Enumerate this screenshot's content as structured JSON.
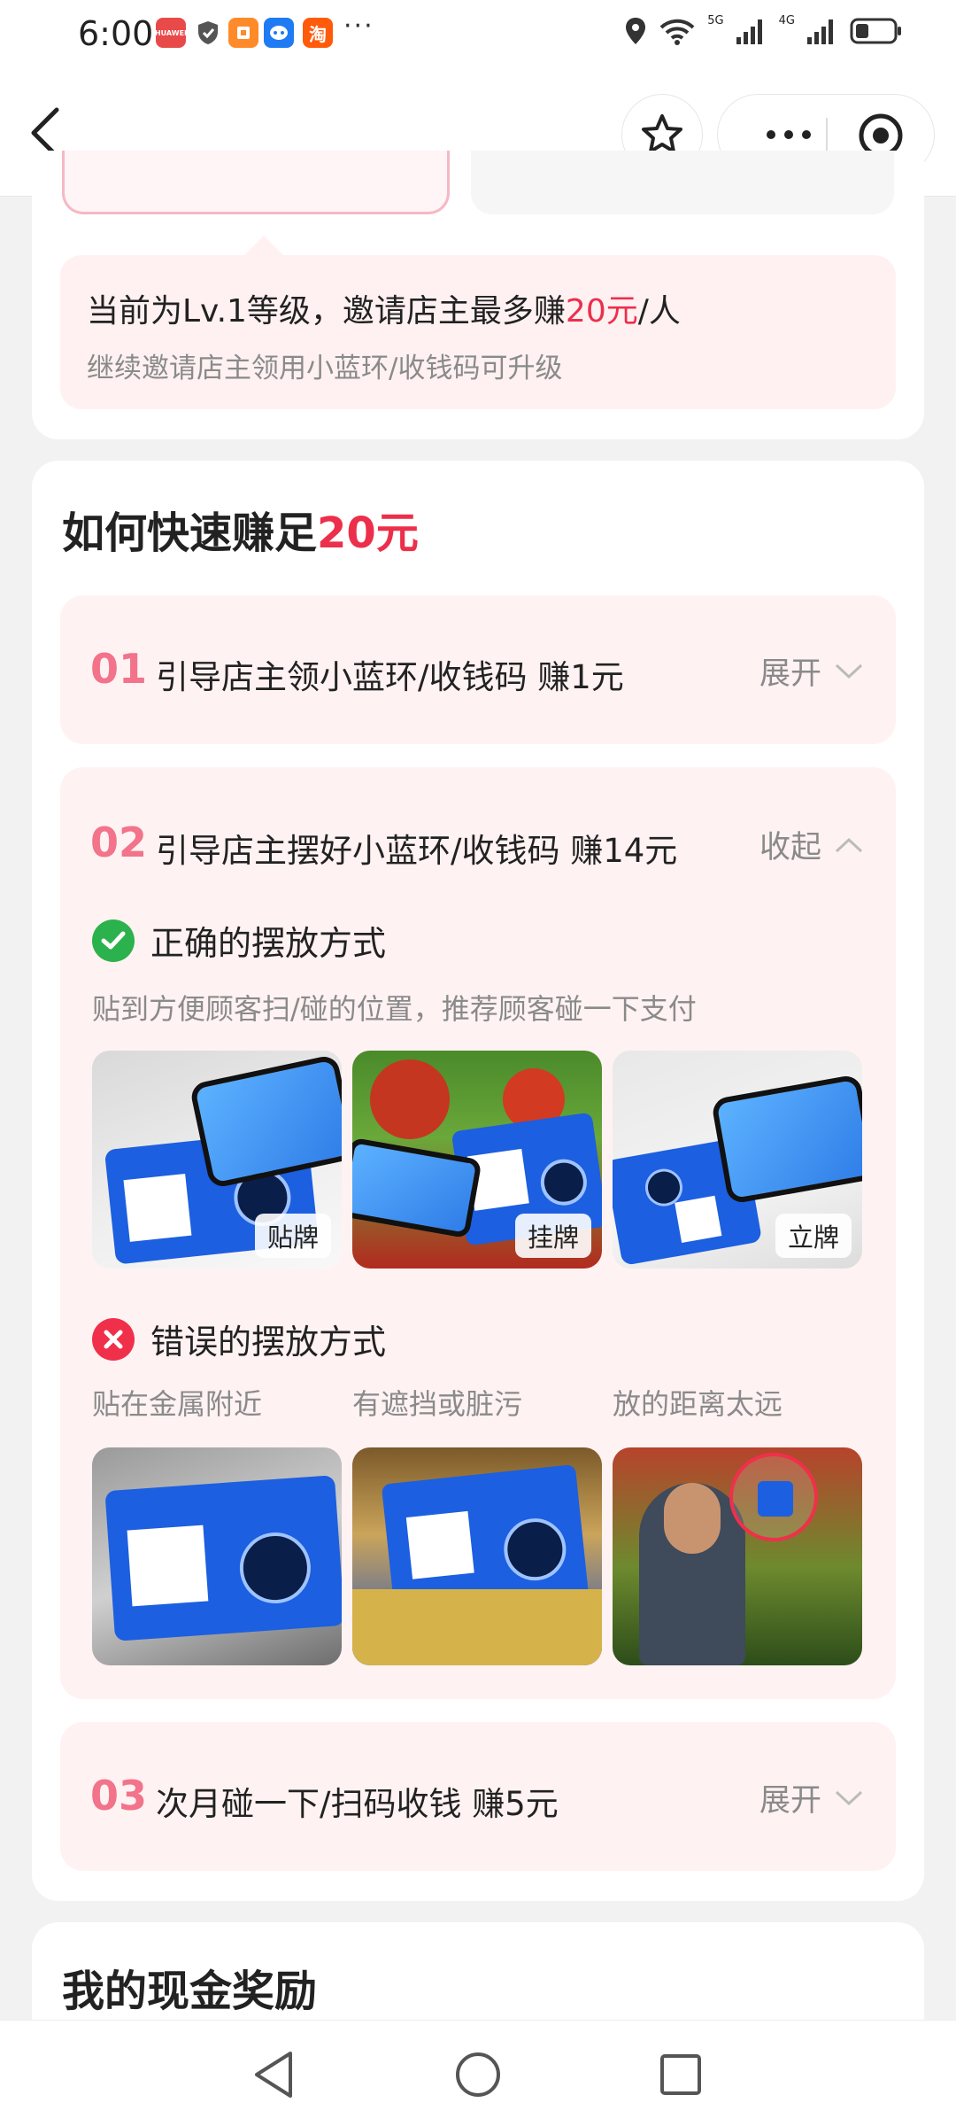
{
  "status_bar": {
    "time": "6:00",
    "app_icons": [
      "huawei-app-icon",
      "shield-icon",
      "app-icon",
      "bot-icon",
      "taobao-icon"
    ],
    "app_icon_labels": {
      "huawei": "HUAWEI",
      "taobao": "淘"
    },
    "more": "···",
    "net_5g": "5G",
    "net_4g": "4G"
  },
  "nav": {
    "back_icon": "chevron-left-icon",
    "star_icon": "star-icon",
    "more_icon": "more-dots-icon",
    "close_icon": "target-icon"
  },
  "level": {
    "main_prefix": "当前为Lv.1等级，邀请店主最多赚",
    "main_amount": "20元",
    "main_suffix": "/人",
    "sub": "继续邀请店主领用小蓝环/收钱码可升级"
  },
  "guide": {
    "title_prefix": "如何快速赚足",
    "title_amount": "20元",
    "steps": [
      {
        "num": "01",
        "text": "引导店主领小蓝环/收钱码 赚1元",
        "toggle": "展开"
      },
      {
        "num": "02",
        "text": "引导店主摆好小蓝环/收钱码 赚14元",
        "toggle": "收起"
      },
      {
        "num": "03",
        "text": "次月碰一下/扫码收钱 赚5元",
        "toggle": "展开"
      }
    ],
    "correct": {
      "title": "正确的摆放方式",
      "desc": "贴到方便顾客扫/碰的位置，推荐顾客碰一下支付",
      "tags": [
        "贴牌",
        "挂牌",
        "立牌"
      ]
    },
    "wrong": {
      "title": "错误的摆放方式",
      "labels": [
        "贴在金属附近",
        "有遮挡或脏污",
        "放的距离太远"
      ]
    }
  },
  "rewards": {
    "title": "我的现金奖励"
  },
  "colors": {
    "accent": "#ec2f4b",
    "step_num": "#f2738a",
    "step_bg": "#fff2f3",
    "ok_green": "#2bb24c",
    "err_red": "#f0304a"
  }
}
